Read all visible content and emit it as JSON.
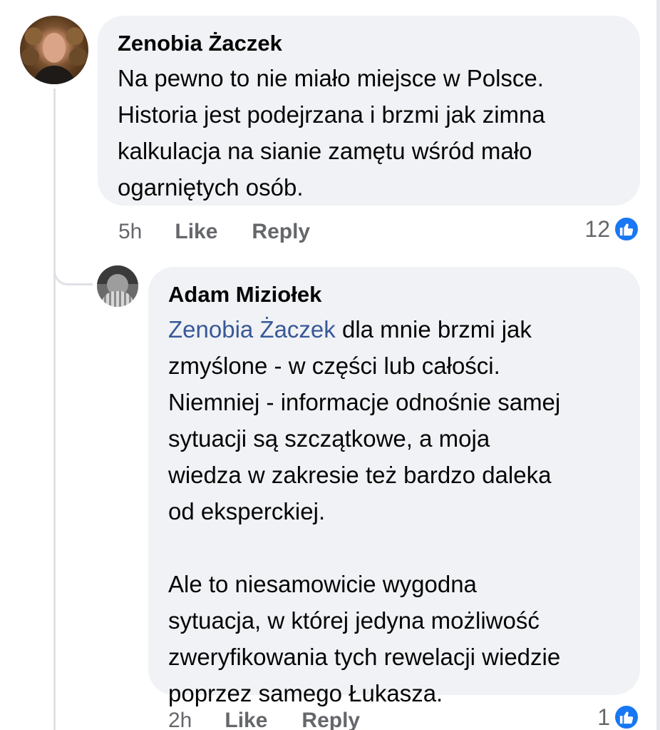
{
  "comments": [
    {
      "author": "Zenobia Żaczek",
      "text": "Na pewno to nie miało miejsce w Polsce.\nHistoria jest podejrzana i brzmi jak zimna\nkalkulacja na sianie zamętu wśród mało\nogarniętych osób.",
      "time": "5h",
      "like_label": "Like",
      "reply_label": "Reply",
      "reaction_count": "12",
      "reaction_icon": "thumbs-up-icon"
    },
    {
      "author": "Adam Miziołek",
      "mention": "Zenobia Żaczek",
      "text": " dla mnie brzmi jak\nzmyślone - w części lub całości.\nNiemniej - informacje odnośnie samej\nsytuacji są szczątkowe, a moja\nwiedza w zakresie też bardzo daleka\nod eksperckiej.\n\nAle to niesamowicie wygodna\nsytuacja, w której jedyna możliwość\nzweryfikowania tych rewelacji wiedzie\npoprzez samego Łukasza.",
      "time": "2h",
      "like_label": "Like",
      "reply_label": "Reply",
      "reaction_count": "1",
      "reaction_icon": "thumbs-up-icon"
    }
  ],
  "colors": {
    "bubble_bg": "#f0f2f5",
    "mention": "#385898",
    "meta_text": "#65676b",
    "like_blue": "#1877f2"
  }
}
